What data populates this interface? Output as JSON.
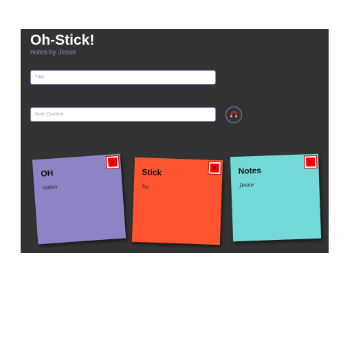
{
  "header": {
    "title": "Oh-Stick!",
    "subtitle": "notes by Jesse"
  },
  "form": {
    "title_placeholder": "Title",
    "content_placeholder": "Note Content",
    "add_button_icon": "magnet-icon"
  },
  "notes": [
    {
      "title": "OH",
      "content": "notes",
      "color": "#8c84c4",
      "close_label": "X"
    },
    {
      "title": "Stick",
      "content": "by",
      "color": "#ff5430",
      "close_label": "X"
    },
    {
      "title": "Notes",
      "content": "Jesse",
      "color": "#74d9d9",
      "close_label": "X"
    }
  ],
  "colors": {
    "background": "#333333",
    "accent": "#8c84c4",
    "close": "#ff0000"
  }
}
